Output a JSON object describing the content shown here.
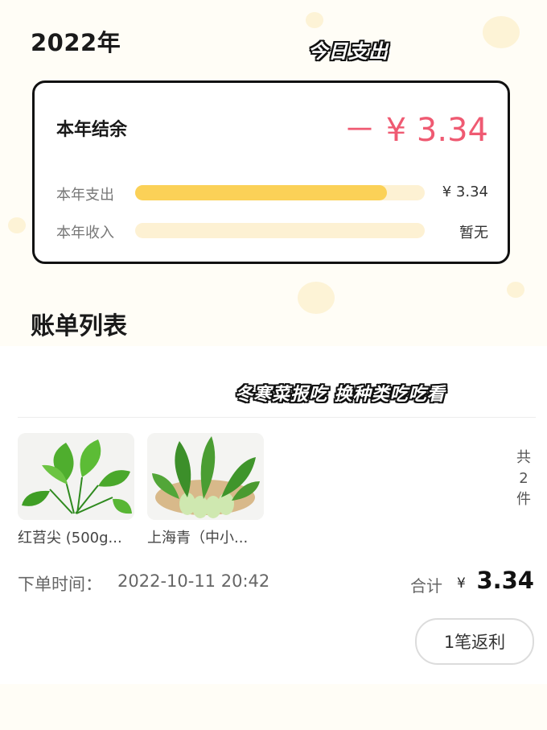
{
  "header": {
    "year": "2022年",
    "sticker_top": "今日支出"
  },
  "summary": {
    "balance_label": "本年结余",
    "balance_value": "－ ¥ 3.34",
    "expense_label": "本年支出",
    "expense_value": "¥ 3.34",
    "expense_ratio": 0.87,
    "income_label": "本年收入",
    "income_value": "暂无"
  },
  "list": {
    "title": "账单列表",
    "sticker_mid": "冬寒菜报吃 换种类吃吃看"
  },
  "order": {
    "products": [
      {
        "name": "红苕尖 (500g...",
        "icon": "leafy-greens-icon"
      },
      {
        "name": "上海青（中小...",
        "icon": "bok-choy-icon"
      }
    ],
    "count_lines": [
      "共",
      "2",
      "件"
    ],
    "time_label": "下单时间：",
    "time_value": "2022-10-11 20:42",
    "total_label": "合计",
    "total_currency": "¥",
    "total_value": "3.34",
    "rebate_button": "1笔返利"
  },
  "colors": {
    "accent_red": "#ef5a72",
    "bar_yellow": "#fbd157",
    "bar_track": "#fdf1d3"
  }
}
